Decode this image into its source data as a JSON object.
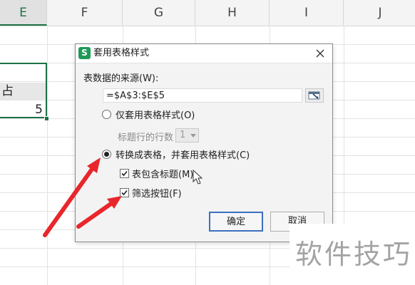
{
  "sheet": {
    "columns": [
      "E",
      "F",
      "G",
      "H",
      "I",
      "J"
    ],
    "active_column": "E",
    "cell_e4": "占",
    "cell_e5": "5"
  },
  "dialog": {
    "title": "套用表格样式",
    "app_icon_glyph": "S",
    "source_label": "表数据的来源(W):",
    "range_value": "=$A$3:$E$5",
    "option_style_only": "仅套用表格样式(O)",
    "header_rows_label": "标题行的行数",
    "header_rows_value": "1",
    "option_convert": "转换成表格，并套用表格样式(C)",
    "checkbox_has_headers": "表包含标题(M)",
    "checkbox_filter_buttons": "筛选按钮(F)",
    "ok_label": "确定",
    "cancel_label": "取消"
  },
  "watermark": "软件技巧",
  "colors": {
    "accent_green": "#1e7145",
    "arrow_red": "#e8262b",
    "ok_border": "#3b6fbf"
  }
}
